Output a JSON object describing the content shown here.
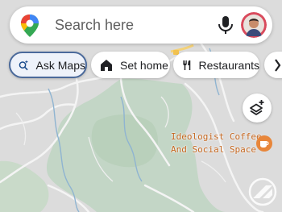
{
  "search": {
    "placeholder": "Search here",
    "logo_icon": "maps-pin-logo-icon",
    "mic_icon": "microphone-icon",
    "avatar_icon": "user-avatar-icon"
  },
  "chips": [
    {
      "label": "Ask Maps",
      "icon": "sparkle-search-icon",
      "selected": true
    },
    {
      "label": "Set home",
      "icon": "home-icon",
      "selected": false
    },
    {
      "label": "Restaurants",
      "icon": "fork-knife-icon",
      "selected": false
    },
    {
      "label": "",
      "icon": "more-chip-icon",
      "selected": false
    }
  ],
  "map": {
    "layers_icon": "layers-icon",
    "poi": {
      "line1": "Ideologist Coffee",
      "line2": "And Social Space",
      "icon": "cafe-icon",
      "color": "#c4661f"
    },
    "colors": {
      "background": "#dcdcdc",
      "park": "#c3d6c6",
      "road": "#f3f3f3",
      "water": "#8fb4d1",
      "major_road": "#f4d27a"
    }
  },
  "watermark_icon": "watermark-logo-icon"
}
